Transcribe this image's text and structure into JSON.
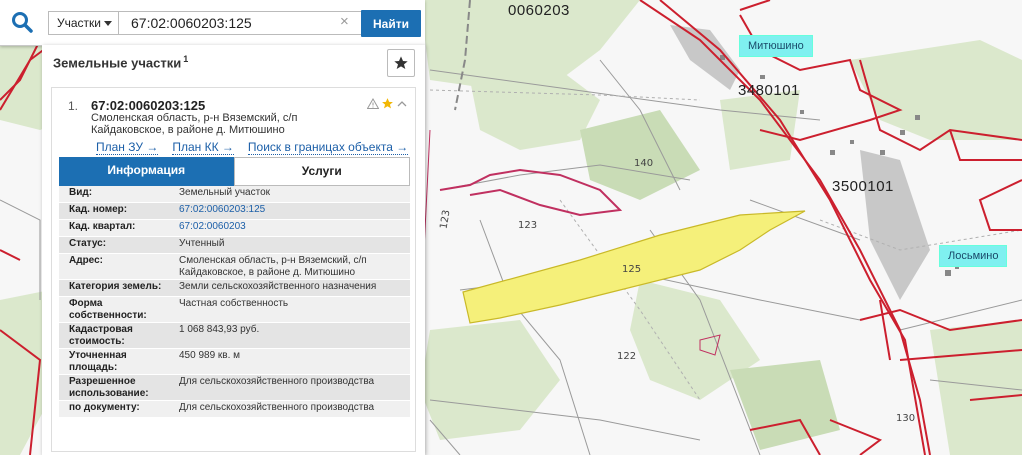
{
  "search": {
    "type_label": "Участки",
    "query": "67:02:0060203:125",
    "find_label": "Найти"
  },
  "panel": {
    "title": "Земельные участки",
    "count": "1",
    "result": {
      "index": "1.",
      "code": "67:02:0060203:125",
      "address": "Смоленская область, р-н Вяземский, с/п Кайдаковское, в районе д. Митюшино"
    },
    "links": [
      "План ЗУ →",
      "План КК →",
      "Поиск в границах объекта →"
    ],
    "tabs": {
      "info": "Информация",
      "services": "Услуги"
    },
    "info_rows": [
      {
        "label": "Вид:",
        "value": "Земельный участок"
      },
      {
        "label": "Кад. номер:",
        "value": "67:02:0060203:125"
      },
      {
        "label": "Кад. квартал:",
        "value": "67:02:0060203"
      },
      {
        "label": "Статус:",
        "value": "Учтенный"
      },
      {
        "label": "Адрес:",
        "value": "Смоленская область, р-н Вяземский, с/п Кайдаковское, в районе д. Митюшино"
      },
      {
        "label": "Категория земель:",
        "value": "Земли сельскохозяйственного назначения"
      },
      {
        "label": "Форма собственности:",
        "value": "Частная собственность"
      },
      {
        "label": "Кадастровая стоимость:",
        "value": "1 068 843,93 руб."
      },
      {
        "label": "Уточненная площадь:",
        "value": "450 989 кв. м"
      },
      {
        "label": "Разрешенное использование:",
        "value": "Для сельскохозяйственного производства"
      },
      {
        "label": "по документу:",
        "value": "Для сельскохозяйственного производства"
      }
    ]
  },
  "map": {
    "quarters": [
      "0060203",
      "3480101",
      "3500101"
    ],
    "settlements": [
      "Митюшино",
      "Лосьмино"
    ],
    "parcels": [
      "140",
      "123",
      "125",
      "122",
      "130",
      "123"
    ],
    "highlight_color": "#f5f07a",
    "boundary_color": "#cc1f2e"
  }
}
